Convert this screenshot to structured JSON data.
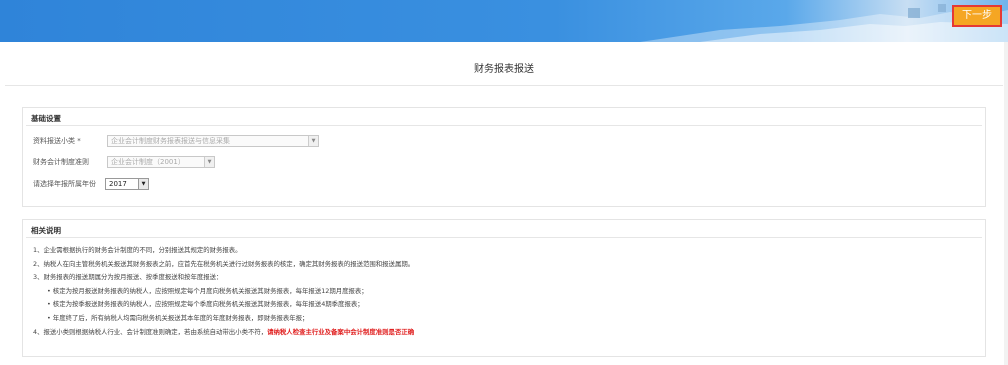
{
  "header": {
    "next_label": "下一步"
  },
  "title": "财务报表报送",
  "basic_settings": {
    "heading": "基础设置",
    "fields": [
      {
        "label": "资料报送小类 *",
        "value": "企业会计制度财务报表报送与信息采集"
      },
      {
        "label": "财务会计制度准则",
        "value": "企业会计制度（2001）"
      },
      {
        "label": "请选择年报所属年份",
        "value": "2017"
      }
    ]
  },
  "notes_section": {
    "heading": "相关说明",
    "items": [
      "1、企业需根据执行的财务会计制度的不同，分别报送其规定的财务报表。",
      "2、纳税人在向主管税务机关报送其财务报表之前，应首先在税务机关进行过财务报表的核定，确定其财务报表的报送范围和报送属期。",
      "3、财务报表的报送期属分为按月报送、按季度报送和按年度报送：",
      "• 核定为按月报送财务报表的纳税人，应按照规定每个月度向税务机关报送其财务报表，每年报送12期月度报表；",
      "• 核定为按季报送财务报表的纳税人，应按照规定每个季度向税务机关报送其财务报表，每年报送4期季度报表；",
      "• 年度终了后，所有纳税人均需向税务机关报送其本年度的年度财务报表，即财务报表年报；"
    ],
    "last_item": {
      "text": "4、报送小类则根据纳税人行业、会计制度准则确定，若由系统自动带出小类不符，",
      "warning": "请纳税人检查主行业及备案中会计制度准则是否正确"
    }
  },
  "colors": {
    "banner": "#3a90e0",
    "next_button": "#f5a623",
    "highlight_border": "#e53935",
    "warning": "#e02020"
  }
}
